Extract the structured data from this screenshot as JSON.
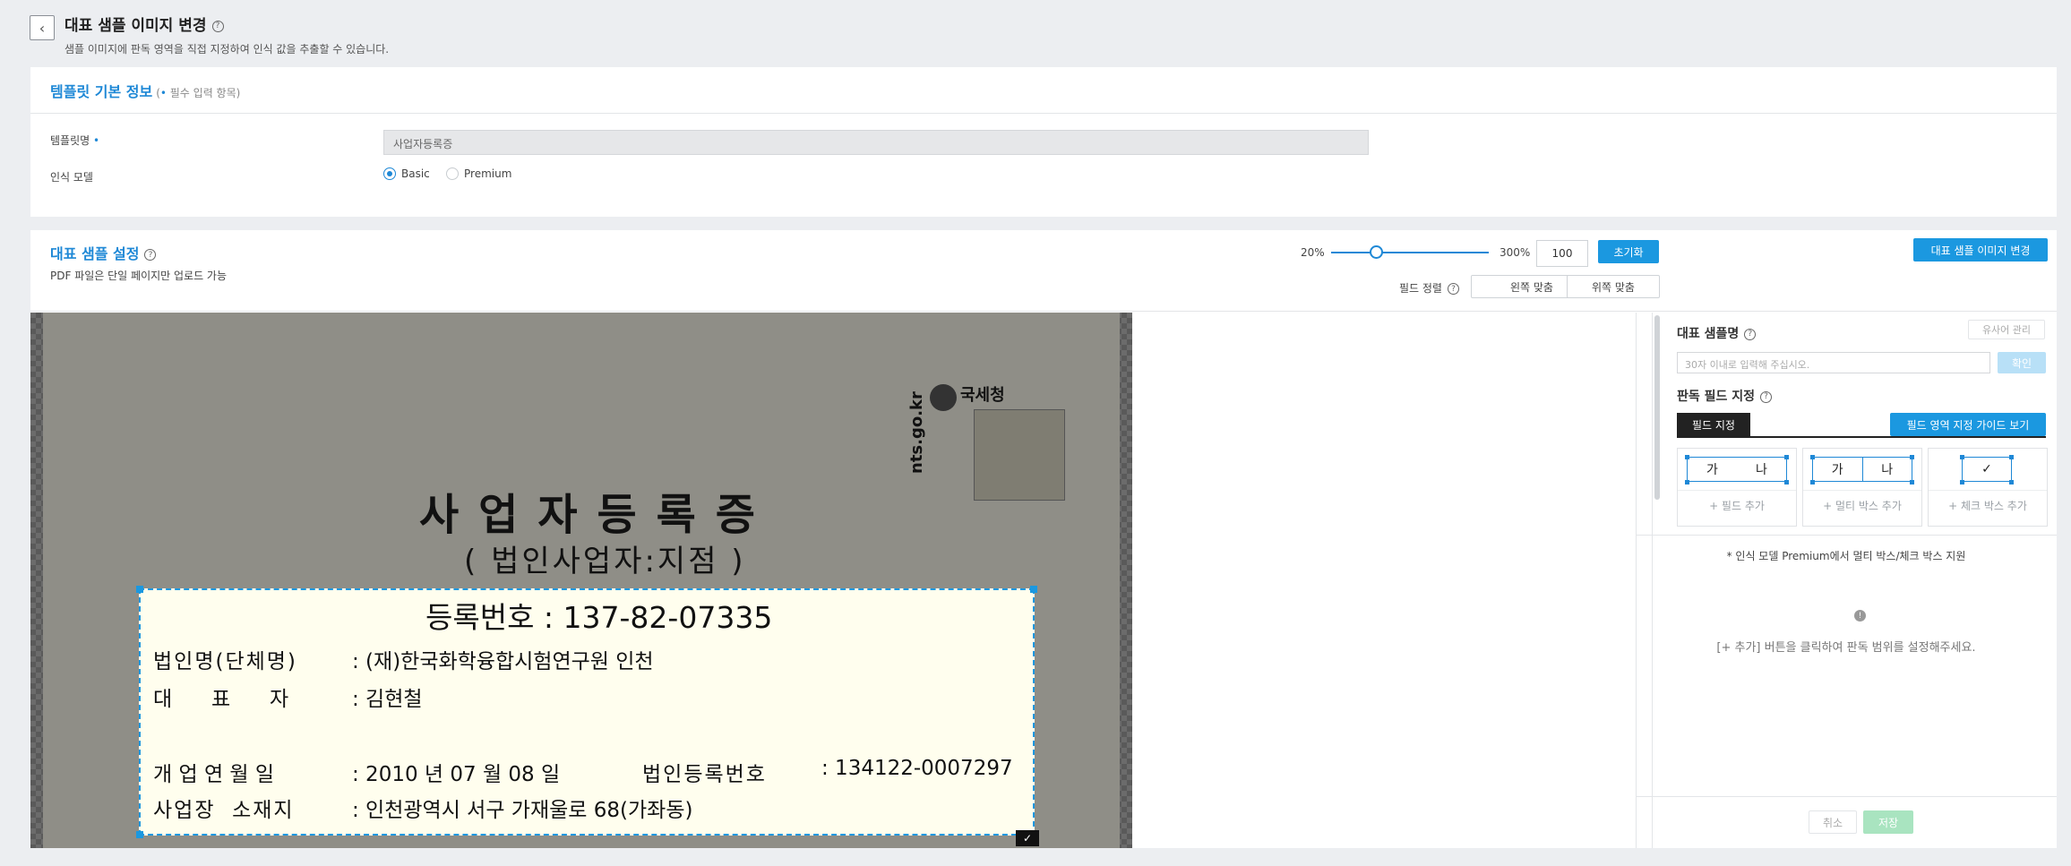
{
  "header": {
    "back_icon": "chevron-left-icon",
    "title": "대표 샘플 이미지 변경",
    "help": "?",
    "description": "샘플 이미지에 판독 영역을 직접 지정하여 인식 값을 추출할 수 있습니다."
  },
  "basic_info": {
    "title": "템플릿 기본 정보",
    "required_note_open": "(",
    "required_dot": "•",
    "required_note": " 필수 입력 항목)",
    "template_name_label": "템플릿명",
    "required_mark": "•",
    "template_name_value": "사업자등록증",
    "model_label": "인식 모델",
    "model_options": [
      "Basic",
      "Premium"
    ],
    "model_selected": "Basic"
  },
  "sample_settings": {
    "title": "대표 샘플 설정",
    "help": "?",
    "pdf_note": "PDF 파일은 단일 페이지만 업로드 가능",
    "zoom_min": "20%",
    "zoom_max": "300%",
    "zoom_value": "100",
    "zoom_level": 0.286,
    "reset_button": "초기화",
    "change_image_button": "대표 샘플 이미지 변경",
    "field_align_label": "필드 정렬",
    "align_left_button": "왼쪽 맞춤",
    "align_top_button": "위쪽 맞춤"
  },
  "document": {
    "agency": "국세청",
    "site": "nts.go.kr",
    "title": "사업자등록증",
    "subtitle": "( 법인사업자:지점 )",
    "reg_no": "등록번호 : 137-82-07335",
    "corp_name_label": "법인명(단체명)",
    "corp_name": ": (재)한국화학융합시험연구원 인천",
    "rep_label": "대      표      자",
    "rep_name": ": 김현철",
    "open_date_label": "개 업 연 월 일",
    "open_date": ": 2010 년 07 월 08 일",
    "corp_reg_label": "법인등록번호",
    "corp_reg_no": ": 134122-0007297",
    "address_label": "사업장  소재지",
    "address": ": 인천광역시 서구 가재울로 68(가좌동)",
    "confirm_icon": "check-icon"
  },
  "right_panel": {
    "sample_name_title": "대표 샘플명",
    "help": "?",
    "history_button": "유사어 관리",
    "sample_name_placeholder": "30자 이내로 입력해 주십시오.",
    "confirm_button": "확인",
    "field_title": "판독 필드 지정",
    "tab_field": "필드 지정",
    "guide_button": "필드 영역 지정 가이드 보기",
    "tiles": [
      {
        "cells": [
          "가",
          "나"
        ],
        "add": "+ 필드 추가"
      },
      {
        "cells": [
          "가",
          "나"
        ],
        "add": "+ 멀티 박스 추가"
      },
      {
        "cells": [
          "✓"
        ],
        "add": "+ 체크 박스 추가"
      }
    ],
    "premium_note": "* 인식 모델 Premium에서 멀티 박스/체크 박스 지원",
    "info_icon": "info-icon",
    "empty_message": "[+ 추가] 버튼을 클릭하여 판독 범위를 설정해주세요.",
    "cancel_button": "취소",
    "save_button": "저장"
  }
}
